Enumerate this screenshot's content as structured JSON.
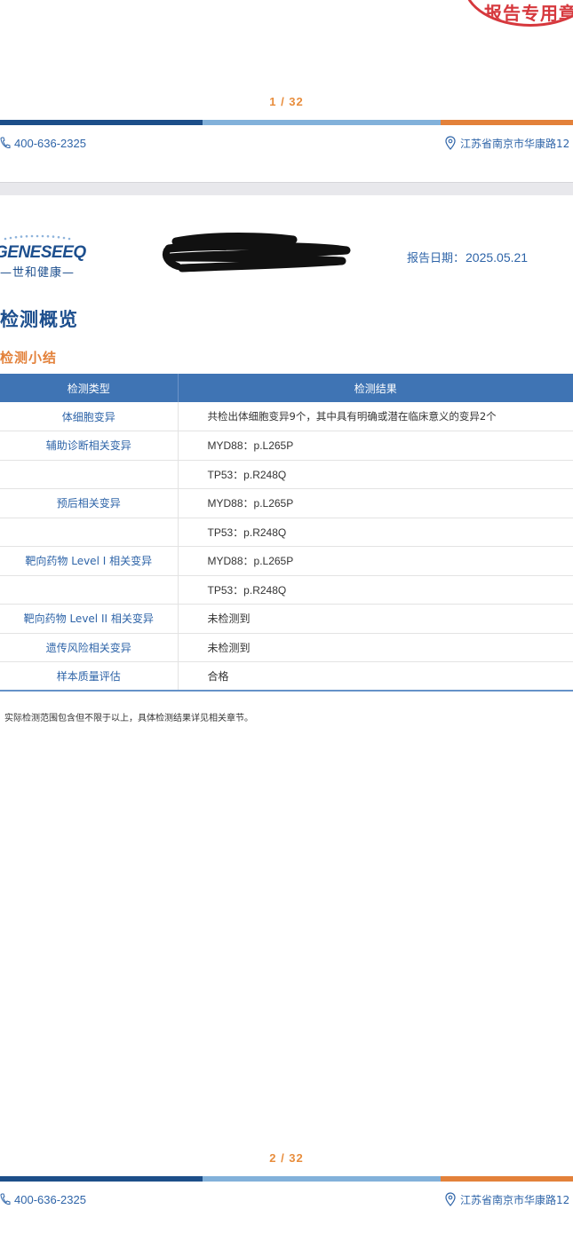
{
  "page1": {
    "stamp_text": "报告专用章",
    "page_number": "1 / 32",
    "footer": {
      "phone": "400-636-2325",
      "address": "江苏省南京市华康路12"
    }
  },
  "page2": {
    "logo": {
      "word": "GENESEEQ",
      "sub": "—世和健康—"
    },
    "report_date_label": "报告日期：",
    "report_date_value": "2025.05.21",
    "section_title": "检测概览",
    "subsection_title": "检测小结",
    "table": {
      "headers": [
        "检测类型",
        "检测结果"
      ],
      "rows": [
        {
          "type": "体细胞变异",
          "result": "共检出体细胞变异9个，其中具有明确或潜在临床意义的变异2个"
        },
        {
          "type": "辅助诊断相关变异",
          "result": "MYD88：p.L265P"
        },
        {
          "type": "",
          "result": "TP53：p.R248Q"
        },
        {
          "type": "预后相关变异",
          "result": "MYD88：p.L265P"
        },
        {
          "type": "",
          "result": "TP53：p.R248Q"
        },
        {
          "type": "靶向药物 Level I 相关变异",
          "result": "MYD88：p.L265P"
        },
        {
          "type": "",
          "result": "TP53：p.R248Q"
        },
        {
          "type": "靶向药物 Level II 相关变异",
          "result": "未检测到"
        },
        {
          "type": "遗传风险相关变异",
          "result": "未检测到"
        },
        {
          "type": "样本质量评估",
          "result": "合格"
        }
      ]
    },
    "note": "实际检测范围包含但不限于以上，具体检测结果详见相关章节。",
    "page_number": "2 / 32",
    "footer": {
      "phone": "400-636-2325",
      "address": "江苏省南京市华康路12"
    }
  },
  "colors": {
    "brand_blue": "#1d4f8e",
    "accent_orange": "#e3813a",
    "header_blue": "#3f74b4",
    "stamp_red": "#d6383d"
  },
  "icons": [
    "phone-icon",
    "location-pin-icon"
  ]
}
